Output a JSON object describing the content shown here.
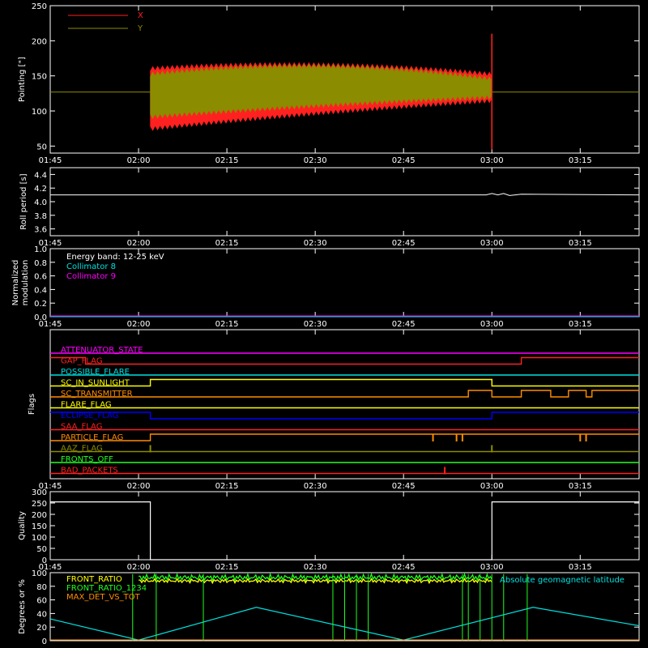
{
  "time_ticks": [
    "01:45",
    "02:00",
    "02:15",
    "02:30",
    "02:45",
    "03:00",
    "03:15"
  ],
  "colors": {
    "axis": "#ffffff",
    "x_series": "#ff2020",
    "y_series": "#8c8c00",
    "cyan": "#00e0e0",
    "magenta": "#ff00ff",
    "yellow": "#ffff00",
    "green": "#20ff20",
    "orange": "#ff8c00"
  },
  "chart_data": [
    {
      "type": "area",
      "ylabel": "Pointing [\"]",
      "ylim": [
        40,
        250
      ],
      "yticks": [
        "50",
        "100",
        "150",
        "200",
        "250"
      ],
      "legend": [
        "X",
        "Y"
      ],
      "legend_placement": "top-left",
      "data_range": [
        "02:02",
        "03:00"
      ],
      "baseline": 127,
      "series": [
        {
          "name": "X",
          "upper_start": 160,
          "upper_mid": 175,
          "upper_end": 152,
          "lower_start": 75,
          "lower_mid": 100,
          "lower_end": 115
        },
        {
          "name": "Y",
          "upper_start": 152,
          "upper_mid": 178,
          "upper_end": 145,
          "lower_start": 92,
          "lower_mid": 110,
          "lower_end": 120
        }
      ]
    },
    {
      "type": "line",
      "ylabel": "Roll period [s]",
      "ylim": [
        3.5,
        4.5
      ],
      "yticks": [
        "3.6",
        "3.8",
        "4.0",
        "4.2",
        "4.4"
      ],
      "points": [
        [
          "01:45",
          4.1
        ],
        [
          "02:59",
          4.1
        ],
        [
          "03:00",
          4.12
        ],
        [
          "03:01",
          4.1
        ],
        [
          "03:02",
          4.12
        ],
        [
          "03:03",
          4.09
        ],
        [
          "03:05",
          4.11
        ],
        [
          "03:25",
          4.1
        ]
      ]
    },
    {
      "type": "line",
      "ylabel_lines": [
        "Normalized",
        "modulation"
      ],
      "ylim": [
        0,
        1
      ],
      "yticks": [
        "0.0",
        "0.2",
        "0.4",
        "0.6",
        "0.8",
        "1.0"
      ],
      "legend": [
        "Energy band: 12-25 keV",
        "Collimator 8",
        "Collimator 9"
      ],
      "series": [
        {
          "name": "Collimator 8",
          "value": 0.0
        },
        {
          "name": "Collimator 9",
          "value": 0.0
        }
      ]
    },
    {
      "type": "line",
      "ylabel": "Flags",
      "flags": [
        {
          "name": "ATTENUATOR_STATE",
          "color": "#ff00ff",
          "segments": [
            [
              "01:45",
              "03:25",
              0
            ]
          ]
        },
        {
          "name": "GAP_FLAG",
          "color": "#ff2020",
          "segments": [
            [
              "01:45",
              "01:51",
              1
            ],
            [
              "01:51",
              "03:05",
              0
            ],
            [
              "03:05",
              "03:25",
              1
            ]
          ]
        },
        {
          "name": "POSSIBLE_FLARE",
          "color": "#00e0e0",
          "segments": [
            [
              "01:45",
              "03:25",
              0
            ]
          ]
        },
        {
          "name": "SC_IN_SUNLIGHT",
          "color": "#ffff00",
          "segments": [
            [
              "01:45",
              "02:02",
              0
            ],
            [
              "02:02",
              "03:00",
              1
            ],
            [
              "03:00",
              "03:25",
              0
            ]
          ]
        },
        {
          "name": "SC_TRANSMITTER",
          "color": "#ff8c00",
          "segments": [
            [
              "01:45",
              "02:56",
              0
            ],
            [
              "02:56",
              "03:00",
              1
            ],
            [
              "03:00",
              "03:05",
              0
            ],
            [
              "03:05",
              "03:10",
              1
            ],
            [
              "03:10",
              "03:13",
              0
            ],
            [
              "03:13",
              "03:16",
              1
            ],
            [
              "03:16",
              "03:17",
              0
            ],
            [
              "03:17",
              "03:25",
              1
            ]
          ]
        },
        {
          "name": "FLARE_FLAG",
          "color": "#ffff00",
          "segments": [
            [
              "01:45",
              "03:25",
              0
            ]
          ]
        },
        {
          "name": "ECLIPSE_FLAG",
          "color": "#0000ff",
          "segments": [
            [
              "01:45",
              "02:02",
              1
            ],
            [
              "02:02",
              "03:00",
              0
            ],
            [
              "03:00",
              "03:25",
              1
            ]
          ]
        },
        {
          "name": "SAA_FLAG",
          "color": "#ff2020",
          "segments": [
            [
              "01:45",
              "03:25",
              0
            ]
          ]
        },
        {
          "name": "PARTICLE_FLAG",
          "color": "#ff8c00",
          "segments": [
            [
              "01:45",
              "02:02",
              0
            ],
            [
              "02:02",
              "03:25",
              1
            ]
          ],
          "spikes": [
            "02:50",
            "02:54",
            "02:55",
            "03:15",
            "03:16"
          ]
        },
        {
          "name": "AAZ_FLAG",
          "color": "#8c8c00",
          "segments": [
            [
              "01:45",
              "03:25",
              0
            ]
          ],
          "spikes": [
            "02:02",
            "03:00"
          ]
        },
        {
          "name": "FRONTS_OFF",
          "color": "#20ff20",
          "segments": [
            [
              "01:45",
              "03:25",
              0
            ]
          ]
        },
        {
          "name": "BAD_PACKETS",
          "color": "#ff2020",
          "segments": [
            [
              "01:45",
              "03:25",
              0
            ]
          ],
          "spikes": [
            "02:52"
          ]
        }
      ]
    },
    {
      "type": "line",
      "ylabel": "Quality",
      "ylim": [
        0,
        300
      ],
      "yticks": [
        "0",
        "50",
        "100",
        "150",
        "200",
        "250",
        "300"
      ],
      "points": [
        [
          "01:45",
          255
        ],
        [
          "02:02",
          255
        ],
        [
          "02:02",
          0
        ],
        [
          "03:00",
          0
        ],
        [
          "03:00",
          255
        ],
        [
          "03:25",
          255
        ]
      ]
    },
    {
      "type": "line",
      "ylabel": "Degrees or %",
      "ylim": [
        0,
        100
      ],
      "yticks": [
        "0",
        "20",
        "40",
        "60",
        "80",
        "100"
      ],
      "legend": [
        "FRONT_RATIO",
        "FRONT_RATIO_1234",
        "MAX_DET_VS_TOT",
        "Absolute geomagnetic latitude"
      ],
      "latitude": [
        [
          "01:45",
          32
        ],
        [
          "02:00",
          1
        ],
        [
          "02:20",
          49
        ],
        [
          "02:45",
          1
        ],
        [
          "03:07",
          49
        ],
        [
          "03:25",
          22
        ]
      ],
      "front_ratio_level": 88,
      "front_ratio_1234_level": 97,
      "max_det_level": 80
    }
  ]
}
